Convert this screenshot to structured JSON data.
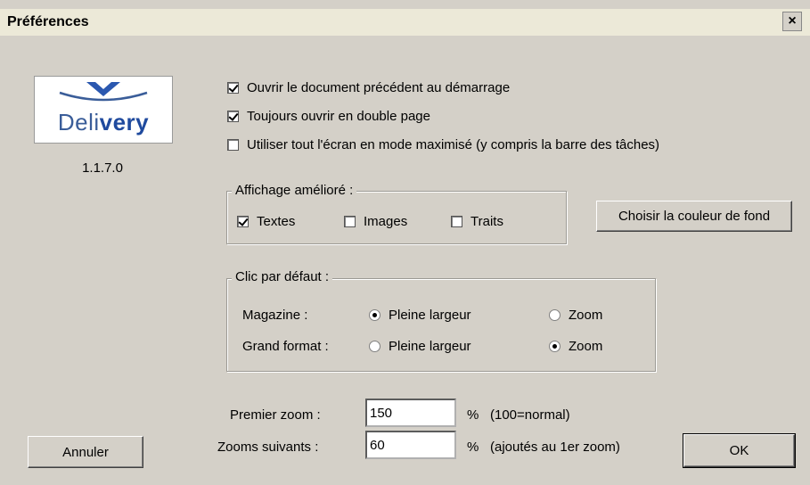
{
  "window": {
    "title": "Préférences",
    "close_glyph": "×"
  },
  "logo": {
    "prefix": "Deli",
    "suffix": "very"
  },
  "version": "1.1.7.0",
  "options": [
    {
      "label": "Ouvrir le document précédent au démarrage",
      "checked": true
    },
    {
      "label": "Toujours ouvrir en double page",
      "checked": true
    },
    {
      "label": "Utiliser tout l'écran en mode maximisé (y compris la barre des tâches)",
      "checked": false
    }
  ],
  "affichage": {
    "label": "Affichage amélioré :",
    "items": [
      {
        "label": "Textes",
        "checked": true
      },
      {
        "label": "Images",
        "checked": false
      },
      {
        "label": "Traits",
        "checked": false
      }
    ]
  },
  "color_button": "Choisir la couleur de fond",
  "clic": {
    "label": "Clic par défaut :",
    "rows": [
      {
        "label": "Magazine :",
        "opt1": "Pleine largeur",
        "opt2": "Zoom",
        "selected": "opt1"
      },
      {
        "label": "Grand format :",
        "opt1": "Pleine largeur",
        "opt2": "Zoom",
        "selected": "opt2"
      }
    ]
  },
  "zoom": {
    "first_label": "Premier zoom :",
    "first_value": "150",
    "first_note": "(100=normal)",
    "next_label": "Zooms suivants :",
    "next_value": "60",
    "next_note": "(ajoutés au 1er zoom)",
    "percent": "%"
  },
  "buttons": {
    "cancel": "Annuler",
    "ok": "OK"
  }
}
